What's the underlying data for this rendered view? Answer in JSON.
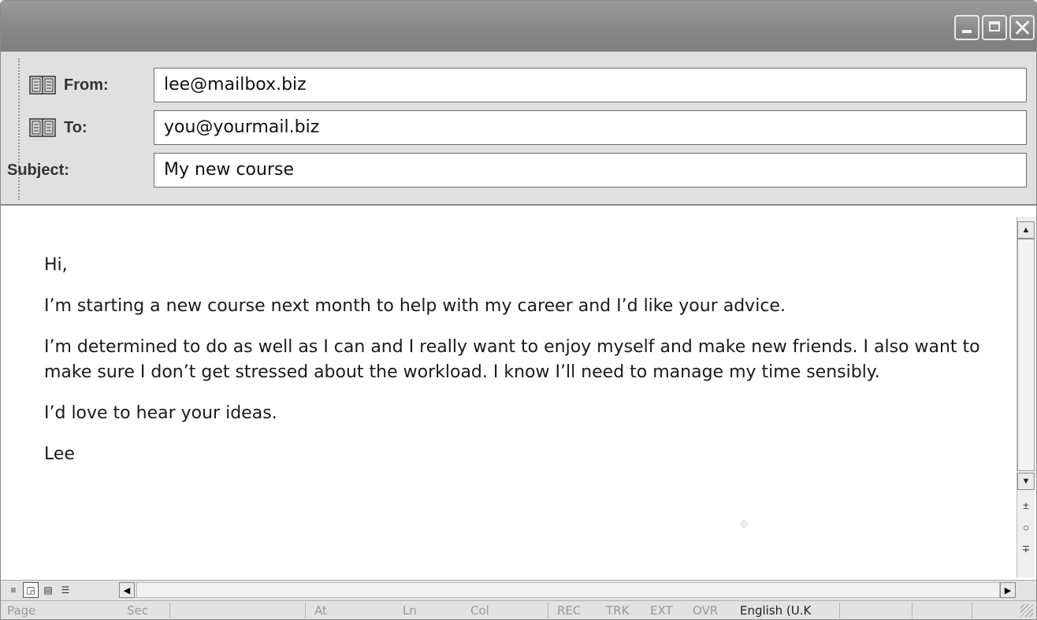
{
  "window": {
    "controls": {
      "minimize_icon": "minimize-icon",
      "maximize_icon": "maximize-icon",
      "close_icon": "close-icon"
    }
  },
  "header": {
    "from": {
      "label": "From:",
      "value": "lee@mailbox.biz",
      "icon": "address-book-icon"
    },
    "to": {
      "label": "To:",
      "value": "you@yourmail.biz",
      "icon": "address-book-icon"
    },
    "subject": {
      "label": "Subject:",
      "value": "My new course"
    }
  },
  "message": {
    "greeting": "Hi,",
    "para1": "I’m starting a new course next month to help with my career and I’d like your advice.",
    "para2": "I’m determined to do as well as I can and I really want to enjoy myself and make new friends. I also want to make sure I don’t get stressed about the workload. I know I’ll need to manage my time sensibly.",
    "para3": "I’d love to hear your ideas.",
    "signoff": "Lee"
  },
  "statusbar": {
    "page": "Page",
    "sec": "Sec",
    "at": "At",
    "ln": "Ln",
    "col": "Col",
    "rec": "REC",
    "trk": "TRK",
    "ext": "EXT",
    "ovr": "OVR",
    "language": "English (U.K"
  }
}
